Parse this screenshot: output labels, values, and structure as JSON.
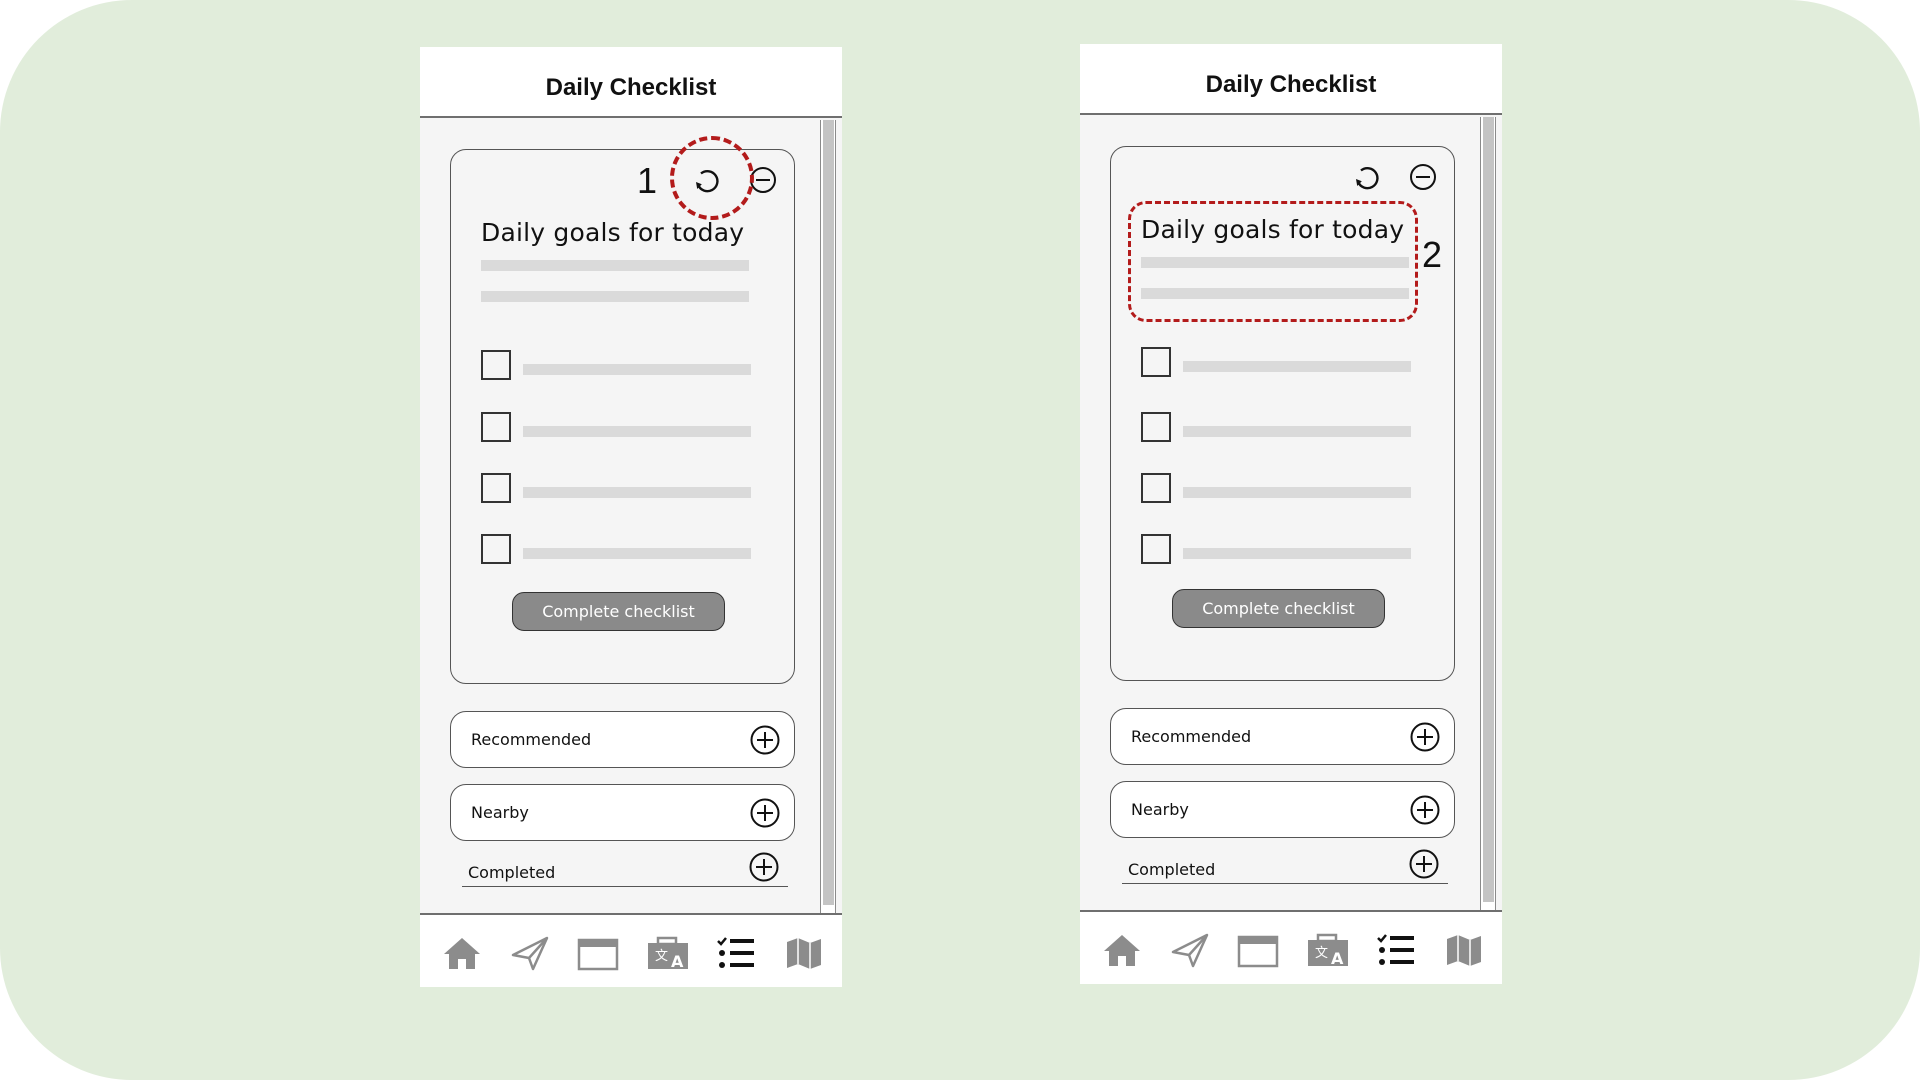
{
  "colors": {
    "background": "#e1eddb",
    "highlight": "#b31b1b",
    "button_fill": "#8a8a8a",
    "icon_gray": "#8c8c8c",
    "icon_active": "#111111"
  },
  "screens": [
    {
      "title": "Daily Checklist",
      "step_number": "1",
      "highlight_target": "refresh-icon",
      "card": {
        "heading": "Daily goals for today",
        "checkbox_count": 4,
        "complete_button": "Complete checklist",
        "icons": [
          "refresh-icon",
          "minus-circle-icon"
        ]
      },
      "sections": [
        {
          "label": "Recommended",
          "icon": "plus-circle-icon"
        },
        {
          "label": "Nearby",
          "icon": "plus-circle-icon"
        },
        {
          "label": "Completed",
          "icon": "plus-circle-icon"
        }
      ],
      "tabs": [
        "home-icon",
        "send-icon",
        "calendar-icon",
        "translate-icon",
        "checklist-icon",
        "map-icon"
      ],
      "active_tab": "checklist-icon"
    },
    {
      "title": "Daily Checklist",
      "step_number": "2",
      "highlight_target": "card-heading",
      "card": {
        "heading": "Daily goals for today",
        "checkbox_count": 4,
        "complete_button": "Complete checklist",
        "icons": [
          "refresh-icon",
          "minus-circle-icon"
        ]
      },
      "sections": [
        {
          "label": "Recommended",
          "icon": "plus-circle-icon"
        },
        {
          "label": "Nearby",
          "icon": "plus-circle-icon"
        },
        {
          "label": "Completed",
          "icon": "plus-circle-icon"
        }
      ],
      "tabs": [
        "home-icon",
        "send-icon",
        "calendar-icon",
        "translate-icon",
        "checklist-icon",
        "map-icon"
      ],
      "active_tab": "checklist-icon"
    }
  ]
}
